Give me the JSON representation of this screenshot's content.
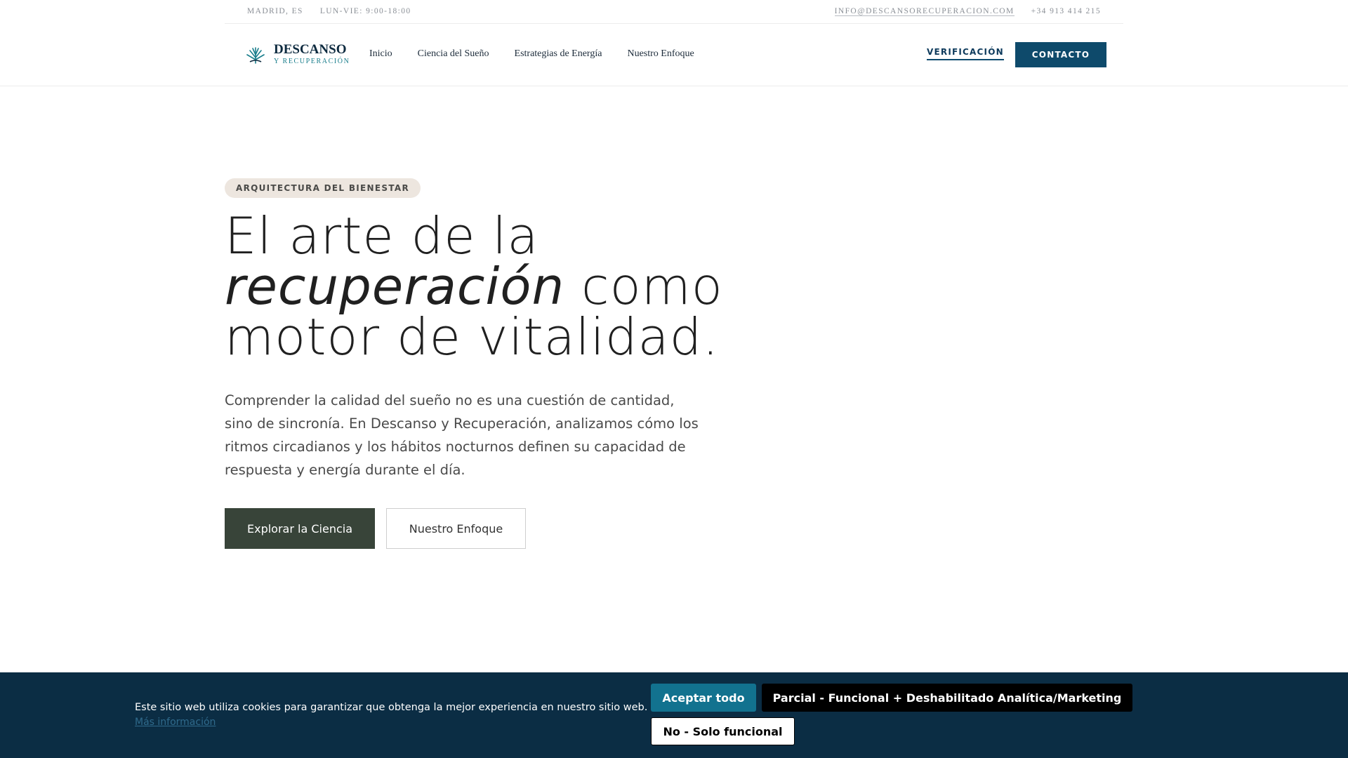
{
  "topbar": {
    "location": "MADRID, ES",
    "hours": "LUN-VIE: 9:00-18:00",
    "email": "INFO@DESCANSORECUPERACION.COM",
    "phone": "+34 913 414 215"
  },
  "brand": {
    "name": "DESCANSO",
    "tagline": "Y RECUPERACIÓN"
  },
  "nav": {
    "items": [
      "Inicio",
      "Ciencia del Sueño",
      "Estrategias de Energía",
      "Nuestro Enfoque"
    ],
    "verification": "VERIFICACIÓN",
    "contact": "CONTACTO"
  },
  "hero": {
    "badge": "ARQUITECTURA DEL BIENESTAR",
    "headline_line1": "El arte de la",
    "headline_em": "recuperación",
    "headline_line2_rest": " como",
    "headline_line3": "motor de vitalidad.",
    "lead": "Comprender la calidad del sueño no es una cuestión de cantidad, sino de sincronía. En Descanso y Recuperación, analizamos cómo los ritmos circadianos y los hábitos nocturnos definen su capacidad de respuesta y energía durante el día.",
    "primary_cta": "Explorar la Ciencia",
    "secondary_cta": "Nuestro Enfoque"
  },
  "cookie": {
    "message": "Este sitio web utiliza cookies para garantizar que obtenga la mejor experiencia en nuestro sitio web.",
    "more": "Más información",
    "accept_all": "Aceptar todo",
    "partial": "Parcial - Funcional + Deshabilitado Analítica/Marketing",
    "functional_only": "No - Solo funcional"
  },
  "colors": {
    "brand_navy": "#0e4a6b",
    "brand_teal": "#1a7e8c",
    "primary_button": "#384439",
    "badge_bg": "#ede6df",
    "cookie_bg": "#0b2d44"
  }
}
